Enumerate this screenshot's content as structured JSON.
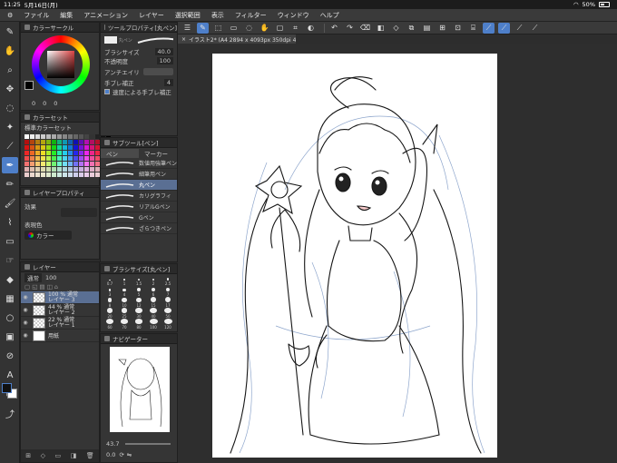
{
  "status_bar": {
    "time": "11:25",
    "date": "5月16日(月)",
    "wifi_icon": "wifi-icon",
    "battery": "50%"
  },
  "menu": [
    "ファイル",
    "編集",
    "アニメーション",
    "レイヤー",
    "選択範囲",
    "表示",
    "フィルター",
    "ウィンドウ",
    "ヘルプ"
  ],
  "tools": [
    "brush-icon",
    "hand-icon",
    "zoom-icon",
    "move-icon",
    "lasso-icon",
    "auto-select-icon",
    "eyedropper-icon",
    "pen-icon",
    "pencil-icon",
    "brush-tip-icon",
    "airbrush-icon",
    "eraser-icon",
    "blend-icon",
    "fill-icon",
    "gradient-icon",
    "figure-icon",
    "frame-icon",
    "text-icon",
    "balloon-icon",
    "ruler-icon",
    "correct-line-icon"
  ],
  "color_circle": {
    "title": "カラーサークル",
    "values": [
      "0",
      "0",
      "0"
    ]
  },
  "color_set": {
    "title": "カラーセット",
    "selected": "標準カラーセット"
  },
  "layer_property": {
    "title": "レイヤープロパティ",
    "effect_label": "効果",
    "expression_label": "表現色",
    "expression_value": "カラー"
  },
  "tool_property": {
    "title": "ツールプロパティ[丸ペン]",
    "brush_name": "丸ペン",
    "brush_size_label": "ブラシサイズ",
    "brush_size_value": "40.0",
    "opacity_label": "不透明度",
    "opacity_value": "100",
    "antialias_label": "アンチエイリ",
    "stabilization_label": "手ブレ補正",
    "stabilization_value": "4",
    "speed_label": "速度による手ブレ補正"
  },
  "sub_tool": {
    "title": "サブツール[ペン]",
    "tabs": [
      "ペン",
      "マーカー"
    ],
    "brushes": [
      "数値用強筆ペン",
      "細筆用ペン",
      "丸ペン",
      "カリグラフィ",
      "リアルGペン",
      "Gペン",
      "ざらつきペン"
    ],
    "selected_index": 2
  },
  "brush_size": {
    "title": "ブラシサイズ[丸ペン]",
    "sizes": [
      "0.7",
      "1",
      "1.5",
      "2",
      "2.5",
      "3",
      "4",
      "5",
      "6",
      "7",
      "8",
      "10",
      "12",
      "15",
      "17",
      "20",
      "25",
      "30",
      "40",
      "50",
      "60",
      "70",
      "80",
      "100",
      "120"
    ]
  },
  "layer_panel": {
    "title": "レイヤー",
    "blend_mode": "通常",
    "opacity": "100",
    "layers": [
      {
        "percent": "100 %",
        "mode": "通常",
        "name": "レイヤー 3",
        "selected": true
      },
      {
        "percent": "44 %",
        "mode": "通常",
        "name": "レイヤー 2",
        "selected": false
      },
      {
        "percent": "22 %",
        "mode": "通常",
        "name": "レイヤー 1",
        "selected": false
      },
      {
        "percent": "",
        "mode": "",
        "name": "用紙",
        "selected": false
      }
    ]
  },
  "navigator": {
    "title": "ナビゲーター",
    "zoom": "43.7",
    "angle": "0.0"
  },
  "document_tab": {
    "label": "イラスト2* (A4 2894 x 4093px 350dpi 43.7%)",
    "close_icon": "close-icon"
  },
  "accent_color": "#4e7fc9",
  "selected_row_color": "#5a6f93"
}
